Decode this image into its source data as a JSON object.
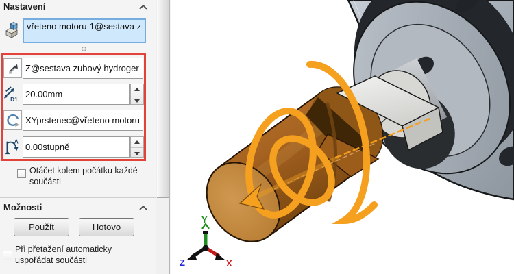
{
  "panel": {
    "section_settings": {
      "title": "Nastavení"
    },
    "component_field": {
      "value": "vřeteno motoru-1@sestava z"
    },
    "translate_field": {
      "value": "Z@sestava zubový hydroger"
    },
    "distance_field": {
      "value": "20.00mm"
    },
    "rotate_field": {
      "value": "XYprstenec@vřeteno motoru"
    },
    "angle_field": {
      "value": "0.00stupně"
    },
    "checkbox_rotate_origin": {
      "label": "Otáčet kolem počátku každé součásti",
      "checked": false
    },
    "section_options": {
      "title": "Možnosti"
    },
    "apply_button": {
      "label": "Použít"
    },
    "done_button": {
      "label": "Hotovo"
    },
    "checkbox_autoarrange": {
      "label": "Při přetažení automaticky uspořádat součásti",
      "checked": false
    }
  },
  "viewport": {
    "triad": {
      "x_label": "X",
      "y_label": "Y",
      "z_label": "Z"
    }
  },
  "colors": {
    "highlight_red": "#e2423a",
    "selection_blue_bg": "#cfe8fb",
    "selection_blue_border": "#75aede",
    "manipulator_orange": "#f5a01e",
    "spindle_brown": "#a76321",
    "housing_grey": "#a7afb8"
  }
}
